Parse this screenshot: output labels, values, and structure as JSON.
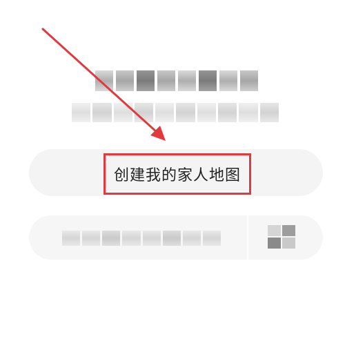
{
  "main": {
    "create_button_label": "创建我的家人地图"
  },
  "annotation": {
    "color": "#e03a3e",
    "icon": "arrow-pointer-icon"
  },
  "colors": {
    "button_background": "#f4f4f4",
    "text": "#222222"
  }
}
